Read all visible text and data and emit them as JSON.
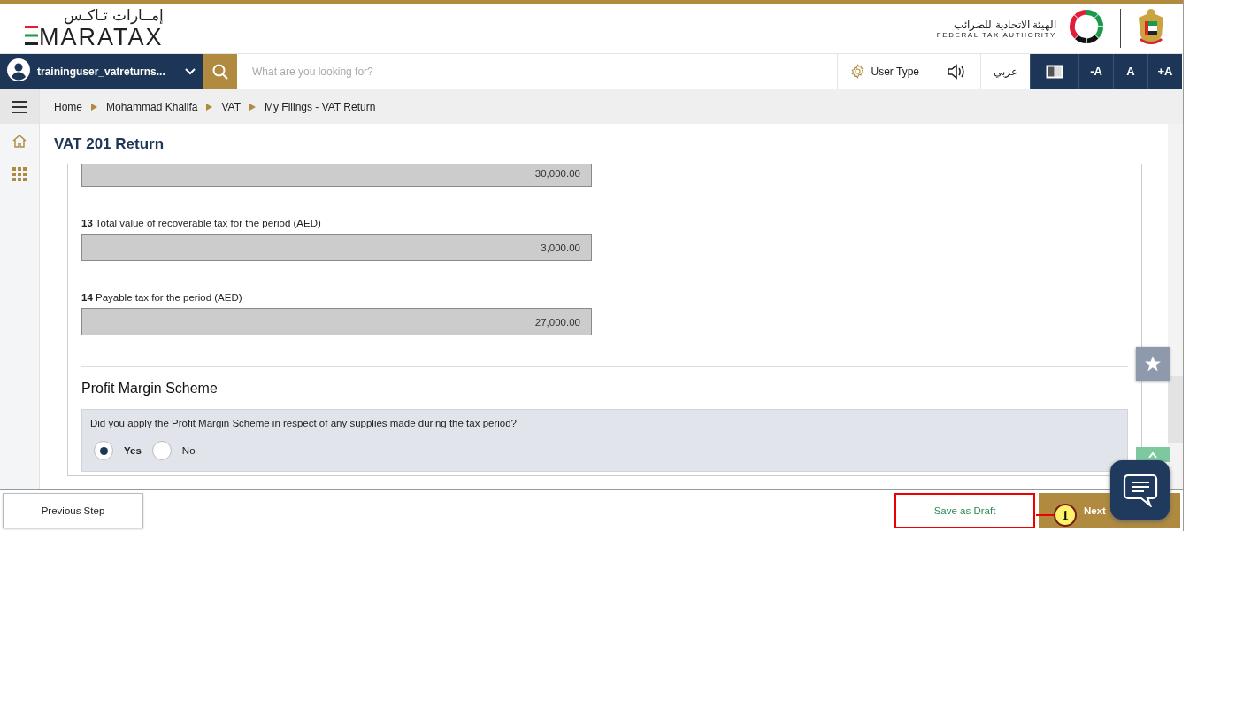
{
  "header": {
    "logo_arabic": "إمــارات تـاكـس",
    "logo_text": "MARATAX",
    "authority_arabic": "الهيئة الاتحادية للضرائب",
    "authority_english": "FEDERAL TAX AUTHORITY"
  },
  "navbar": {
    "user": "traininguser_vatreturns...",
    "search_placeholder": "What are you looking for?",
    "tools": [
      {
        "kind": "settings",
        "label": "User Type",
        "dark": false
      },
      {
        "kind": "sound",
        "dark": false
      },
      {
        "kind": "text",
        "label": "عربي",
        "dark": false
      },
      {
        "kind": "contrast",
        "dark": true
      },
      {
        "kind": "text",
        "label": "-A",
        "dark": true
      },
      {
        "kind": "text",
        "label": "A",
        "dark": true
      },
      {
        "kind": "text",
        "label": "+A",
        "dark": true
      }
    ]
  },
  "breadcrumbs": [
    {
      "label": "Home",
      "link": true
    },
    {
      "label": "Mohammad Khalifa",
      "link": true
    },
    {
      "label": "VAT",
      "link": true
    },
    {
      "label": "My Filings - VAT Return",
      "link": false
    }
  ],
  "page_title": "VAT 201 Return",
  "fields": [
    {
      "value": "30,000.00"
    },
    {
      "label": "**13** Total value of recoverable tax for the period (AED)",
      "value": "3,000.00"
    },
    {
      "label": "**14** Payable tax for the period (AED)",
      "value": "27,000.00"
    }
  ],
  "section": {
    "title": "Profit Margin Scheme",
    "question": "Did you apply the Profit Margin Scheme in respect of any supplies made during the tax period?",
    "options": [
      {
        "label": "Yes",
        "selected": true
      },
      {
        "label": "No",
        "selected": false
      }
    ]
  },
  "footer": {
    "previous": "Previous Step",
    "save": {
      "label": "Save as Draft",
      "highlighted": true
    },
    "next": "Next",
    "callout": "1"
  }
}
